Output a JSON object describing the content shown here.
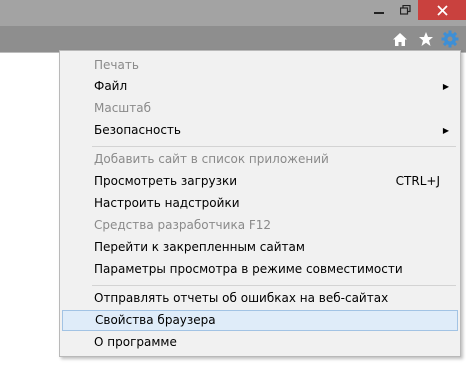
{
  "window": {
    "minimize_icon": "minimize-icon",
    "maximize_icon": "restore-icon",
    "close_icon": "close-icon",
    "close_color": "#c9413e"
  },
  "toolbar": {
    "icons": [
      "home-icon",
      "favorites-star-icon",
      "tools-gear-icon"
    ]
  },
  "menu": {
    "items": [
      {
        "label": "Печать",
        "disabled": true
      },
      {
        "label": "Файл",
        "submenu": true
      },
      {
        "label": "Масштаб",
        "disabled": true
      },
      {
        "label": "Безопасность",
        "submenu": true
      },
      {
        "label": "Добавить сайт в список приложений",
        "disabled": true
      },
      {
        "label": "Просмотреть загрузки",
        "shortcut": "CTRL+J"
      },
      {
        "label": "Настроить надстройки"
      },
      {
        "label": "Средства разработчика F12",
        "disabled": true
      },
      {
        "label": "Перейти к закрепленным сайтам"
      },
      {
        "label": "Параметры просмотра в режиме совместимости"
      },
      {
        "label": "Отправлять отчеты об ошибках на веб-сайтах"
      },
      {
        "label": "Свойства браузера",
        "highlighted": true
      },
      {
        "label": "О программе"
      }
    ],
    "submenu_arrow": "▶",
    "highlight_color": "#dfecf9"
  }
}
